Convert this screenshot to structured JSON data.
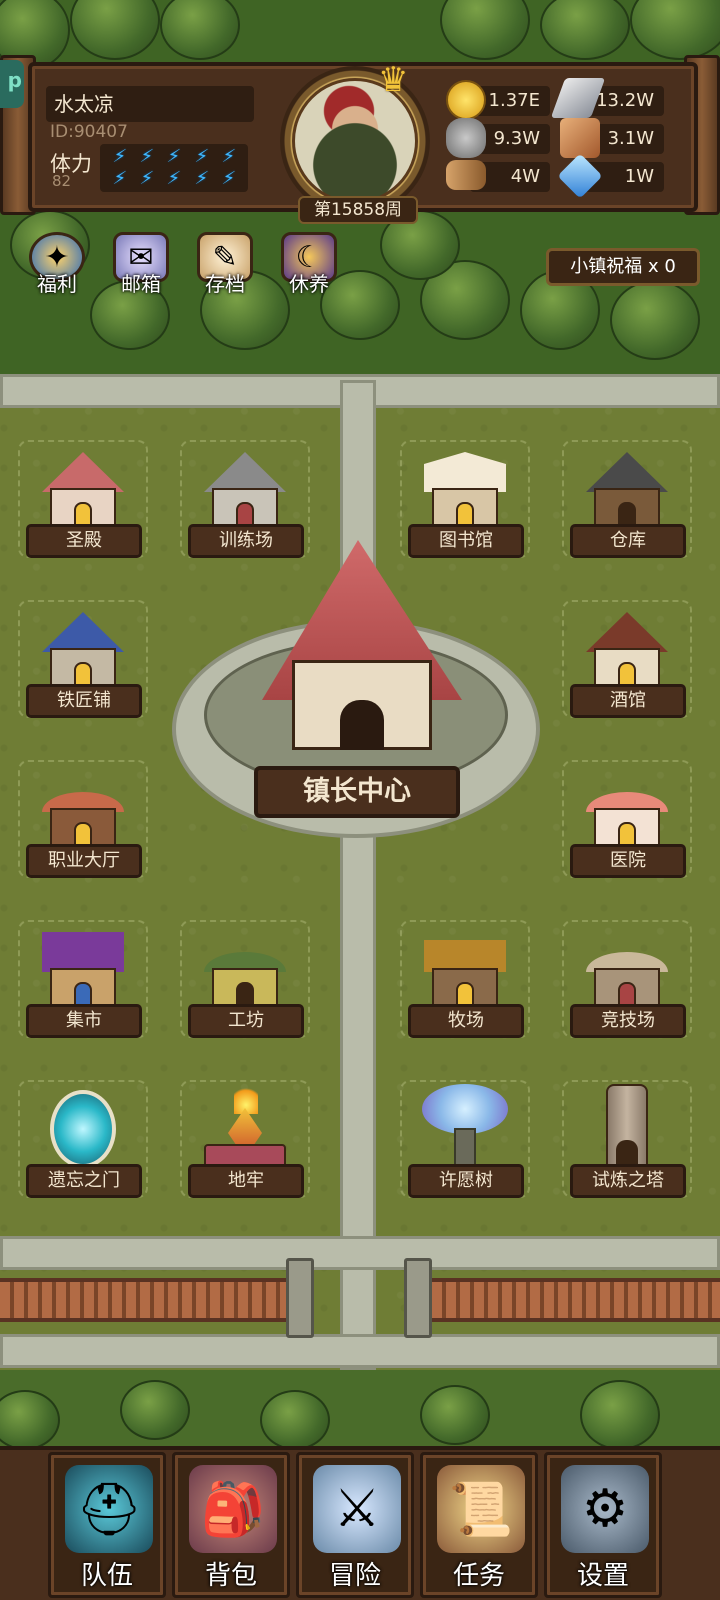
{
  "player": {
    "name": "水太凉",
    "id": "ID:90407",
    "stamina_label": "体力",
    "stamina_value": "82",
    "stamina_bolts": 10,
    "week": "第15858周"
  },
  "resources": {
    "gold": "1.37E",
    "iron": "13.2W",
    "stone": "9.3W",
    "leather": "3.1W",
    "wood": "4W",
    "crystal": "1W"
  },
  "quick_menu": [
    {
      "label": "福利",
      "icon": "shield-icon"
    },
    {
      "label": "邮箱",
      "icon": "mail-icon"
    },
    {
      "label": "存档",
      "icon": "scroll-icon"
    },
    {
      "label": "休养",
      "icon": "rest-icon"
    }
  ],
  "blessing": "小镇祝福 x 0",
  "buildings": {
    "sanctum": "圣殿",
    "training": "训练场",
    "library": "图书馆",
    "warehouse": "仓库",
    "smithy": "铁匠铺",
    "tavern": "酒馆",
    "job_hall": "职业大厅",
    "hospital": "医院",
    "market": "集市",
    "workshop": "工坊",
    "ranch": "牧场",
    "arena": "竞技场",
    "forgotten_gate": "遗忘之门",
    "dungeon": "地牢",
    "wish_tree": "许愿树",
    "trial_tower": "试炼之塔",
    "town_hall": "镇长中心"
  },
  "nav": {
    "team": "队伍",
    "bag": "背包",
    "adventure": "冒险",
    "quest": "任务",
    "settings": "设置"
  },
  "colors": {
    "wood_dark": "#2a1a10",
    "wood": "#4a2f1d",
    "grass": "#6f7d35",
    "road": "#b9bcaa",
    "bolt": "#3fb8ff",
    "gold": "#f2c23a"
  }
}
